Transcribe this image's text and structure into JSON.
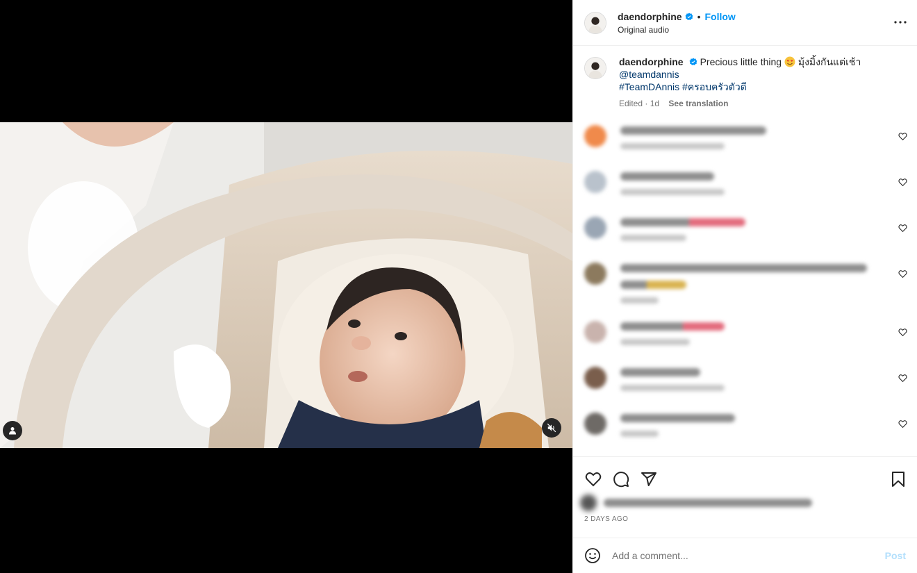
{
  "post": {
    "username": "daendorphine",
    "follow_label": "Follow",
    "separator": "•",
    "audio": "Original audio"
  },
  "caption": {
    "username": "daendorphine",
    "text": "Precious little thing",
    "thai_text": "มุ้งมิ้งกันแต่เช้า",
    "mention": "@teamdannis",
    "hashtag1": "#TeamDAnnis",
    "hashtag2": "#ครอบครัวตัวดี",
    "meta": "Edited · 1d",
    "see_translation": "See translation"
  },
  "comments": [
    {
      "avatar_color": "#f08a4b"
    },
    {
      "avatar_color": "#b9c2cc"
    },
    {
      "avatar_color": "#9aa6b4"
    },
    {
      "avatar_color": "#8c7a5e"
    },
    {
      "avatar_color": "#c9b3ad"
    },
    {
      "avatar_color": "#7a5e4c"
    },
    {
      "avatar_color": "#6e6a66"
    }
  ],
  "date": "2 DAYS AGO",
  "add_comment": {
    "placeholder": "Add a comment...",
    "post_label": "Post"
  },
  "colors": {
    "accent": "#0095f6",
    "link": "#00376b",
    "verified": "#0095f6"
  },
  "icons": [
    "more-icon",
    "verified-icon",
    "heart-icon",
    "comment-icon",
    "share-icon",
    "bookmark-icon",
    "emoji-icon",
    "user-tag-icon",
    "mute-icon"
  ]
}
